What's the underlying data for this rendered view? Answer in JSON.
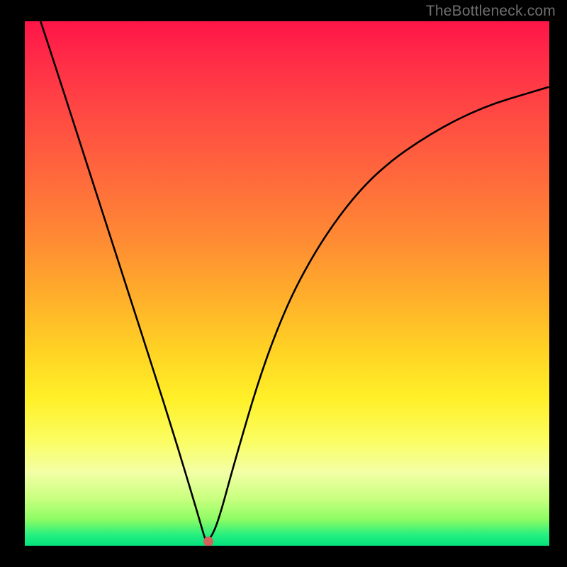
{
  "watermark": "TheBottleneck.com",
  "chart_data": {
    "type": "line",
    "title": "",
    "xlabel": "",
    "ylabel": "",
    "xlim": [
      0,
      100
    ],
    "ylim": [
      0,
      100
    ],
    "grid": false,
    "series": [
      {
        "name": "curve",
        "x": [
          3,
          5,
          10,
          15,
          20,
          25,
          28,
          30,
          31.5,
          33,
          34,
          34.5,
          35.5,
          37,
          40,
          45,
          50,
          55,
          60,
          65,
          70,
          75,
          80,
          85,
          90,
          95,
          100
        ],
        "y": [
          100,
          94,
          78.5,
          63,
          47.5,
          32,
          22.5,
          16,
          11,
          6,
          2.5,
          1,
          1.5,
          5,
          16,
          33,
          46,
          55.5,
          63,
          69,
          73.5,
          77,
          80,
          82.5,
          84.5,
          86,
          87.5
        ]
      }
    ],
    "marker": {
      "x": 35,
      "y": 0.8,
      "color": "#d2635b"
    },
    "background_gradient": [
      "#ff1548",
      "#ff8c33",
      "#fff028",
      "#05e27e"
    ]
  }
}
